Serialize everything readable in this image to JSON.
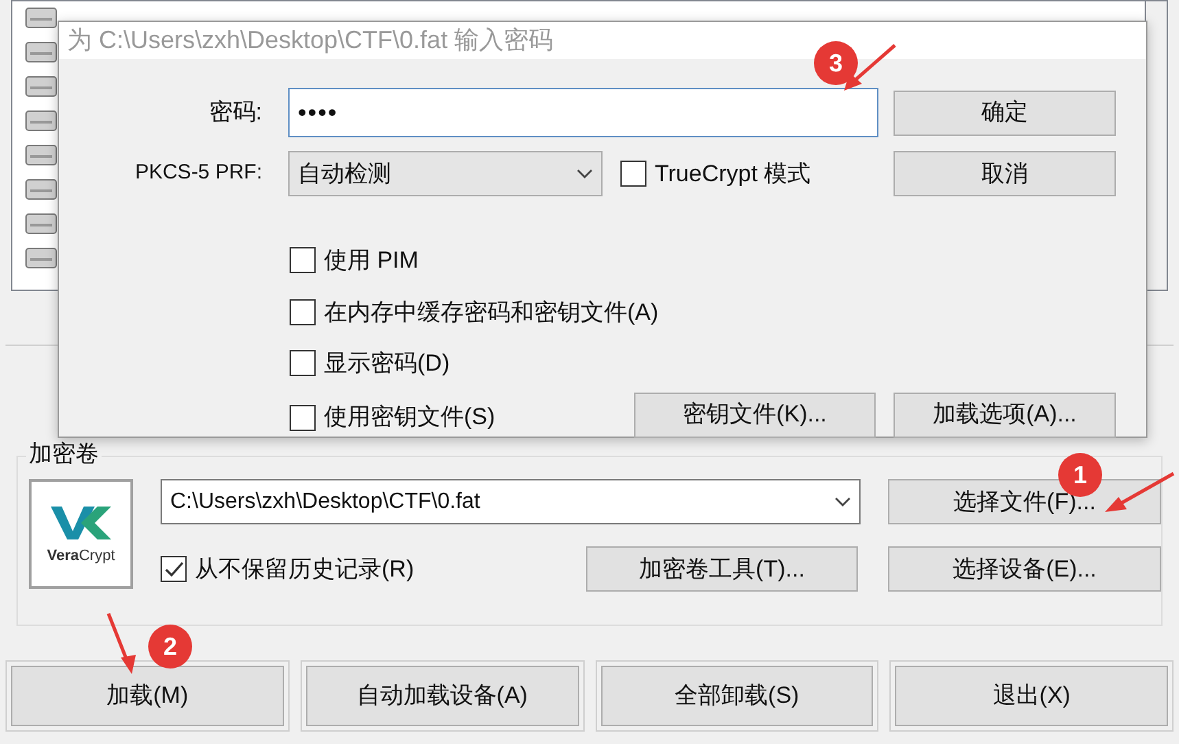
{
  "main_window": {
    "volume_group": {
      "title": "加密卷",
      "logo": "**Vera**Crypt",
      "path": "C:\\Users\\zxh\\Desktop\\CTF\\0.fat",
      "never_save_history": {
        "label": "从不保留历史记录(R)",
        "checked": true
      },
      "select_file": "选择文件(F)...",
      "volume_tools": "加密卷工具(T)...",
      "select_device": "选择设备(E)..."
    },
    "bottom_buttons": [
      "加载(M)",
      "自动加载设备(A)",
      "全部卸载(S)",
      "退出(X)"
    ]
  },
  "dialog": {
    "title": "为 C:\\Users\\zxh\\Desktop\\CTF\\0.fat 输入密码",
    "password_label": "密码:",
    "password_value": "••••",
    "prf_label": "PKCS-5 PRF:",
    "prf_value": "自动检测",
    "truecrypt": {
      "label": "TrueCrypt 模式",
      "checked": false
    },
    "options": [
      {
        "label": "使用 PIM",
        "checked": false
      },
      {
        "label": "在内存中缓存密码和密钥文件(A)",
        "checked": false
      },
      {
        "label": "显示密码(D)",
        "checked": false
      },
      {
        "label": "使用密钥文件(S)",
        "checked": false
      }
    ],
    "ok": "确定",
    "cancel": "取消",
    "keyfiles": "密钥文件(K)...",
    "mount_options": "加载选项(A)..."
  },
  "annotations": [
    {
      "number": "1"
    },
    {
      "number": "2"
    },
    {
      "number": "3"
    }
  ]
}
